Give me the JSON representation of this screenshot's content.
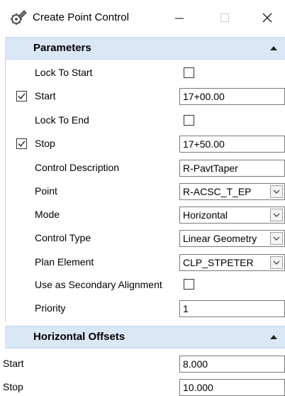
{
  "window": {
    "title": "Create Point Control",
    "icon": "gear-pencil-icon",
    "controls": [
      "minimize-icon",
      "maximize-icon",
      "close-icon"
    ]
  },
  "parameters": {
    "header": "Parameters",
    "rows": {
      "lock_to_start": {
        "label": "Lock To Start",
        "checked": false
      },
      "start": {
        "label": "Start",
        "checked": true,
        "value": "17+00.00"
      },
      "lock_to_end": {
        "label": "Lock To End",
        "checked": false
      },
      "stop": {
        "label": "Stop",
        "checked": true,
        "value": "17+50.00"
      },
      "control_description": {
        "label": "Control Description",
        "value": "R-PavtTaper"
      },
      "point": {
        "label": "Point",
        "value": "R-ACSC_T_EP"
      },
      "mode": {
        "label": "Mode",
        "value": "Horizontal"
      },
      "control_type": {
        "label": "Control Type",
        "value": "Linear Geometry"
      },
      "plan_element": {
        "label": "Plan Element",
        "value": "CLP_STPETER"
      },
      "secondary_alignment": {
        "label": "Use as Secondary Alignment",
        "checked": false
      },
      "priority": {
        "label": "Priority",
        "value": "1"
      }
    }
  },
  "horizontal_offsets": {
    "header": "Horizontal Offsets",
    "start": {
      "label": "Start",
      "value": "8.000"
    },
    "stop": {
      "label": "Stop",
      "value": "10.000"
    }
  },
  "colors": {
    "section_header_bg": "#dae7f7",
    "window_bg": "#ffffff"
  }
}
